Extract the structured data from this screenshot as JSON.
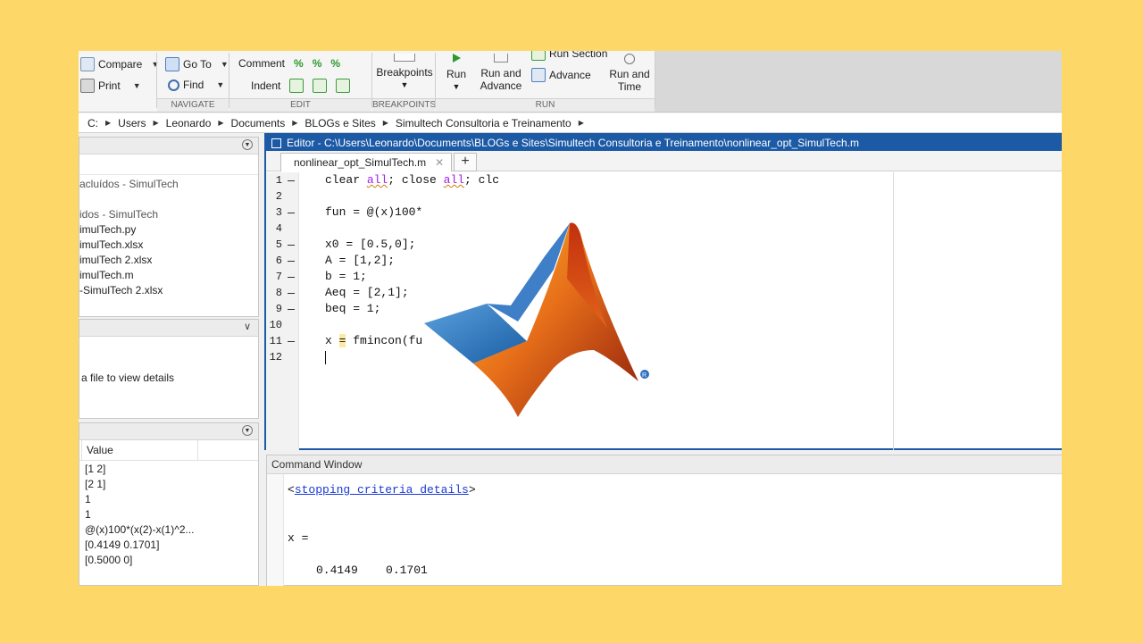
{
  "toolstrip": {
    "file_buttons": {
      "compare": "Compare",
      "print": "Print"
    },
    "navigate": {
      "goto": "Go To",
      "find": "Find",
      "section_label": "NAVIGATE"
    },
    "edit": {
      "comment": "Comment",
      "indent": "Indent",
      "section_label": "EDIT"
    },
    "breakpoints": {
      "label": "Breakpoints",
      "section_label": "BREAKPOINTS"
    },
    "run": {
      "run": "Run",
      "run_advance_1": "Run and",
      "run_advance_2": "Advance",
      "run_section": "Run Section",
      "advance": "Advance",
      "run_time_1": "Run and",
      "run_time_2": "Time",
      "section_label": "RUN"
    }
  },
  "breadcrumb": [
    "C:",
    "Users",
    "Leonardo",
    "Documents",
    "BLOGs e Sites",
    "Simultech Consultoria e Treinamento"
  ],
  "current_folder": {
    "items": [
      "acluídos - SimulTech",
      "",
      "idos - SimulTech",
      "imulTech.py",
      "imulTech.xlsx",
      "imulTech 2.xlsx",
      "imulTech.m",
      "-SimulTech 2.xlsx"
    ]
  },
  "details_panel": {
    "text": "a file to view details"
  },
  "workspace": {
    "column_value": "Value",
    "values": [
      "[1 2]",
      "[2 1]",
      "1",
      "1",
      "@(x)100*(x(2)-x(1)^2...",
      "[0.4149 0.1701]",
      "[0.5000 0]"
    ]
  },
  "editor": {
    "title": "Editor - C:\\Users\\Leonardo\\Documents\\BLOGs e Sites\\Simultech Consultoria e Treinamento\\nonlinear_opt_SimulTech.m",
    "tab": "nonlinear_opt_SimulTech.m",
    "add_tab": "+",
    "lines": [
      {
        "n": "1",
        "t": "clear all; close all; clc"
      },
      {
        "n": "2",
        "t": ""
      },
      {
        "n": "3",
        "t": "fun = @(x)100*"
      },
      {
        "n": "4",
        "t": ""
      },
      {
        "n": "5",
        "t": "x0 = [0.5,0];"
      },
      {
        "n": "6",
        "t": "A = [1,2];"
      },
      {
        "n": "7",
        "t": "b = 1;"
      },
      {
        "n": "8",
        "t": "Aeq = [2,1];"
      },
      {
        "n": "9",
        "t": "beq = 1;"
      },
      {
        "n": "10",
        "t": ""
      },
      {
        "n": "11",
        "t": "x = fmincon(fu"
      },
      {
        "n": "12",
        "t": ""
      }
    ]
  },
  "command_window": {
    "title": "Command Window",
    "link_open": "<",
    "link": "stopping criteria details",
    "link_close": ">",
    "var": "x =",
    "result": "0.4149    0.1701"
  }
}
